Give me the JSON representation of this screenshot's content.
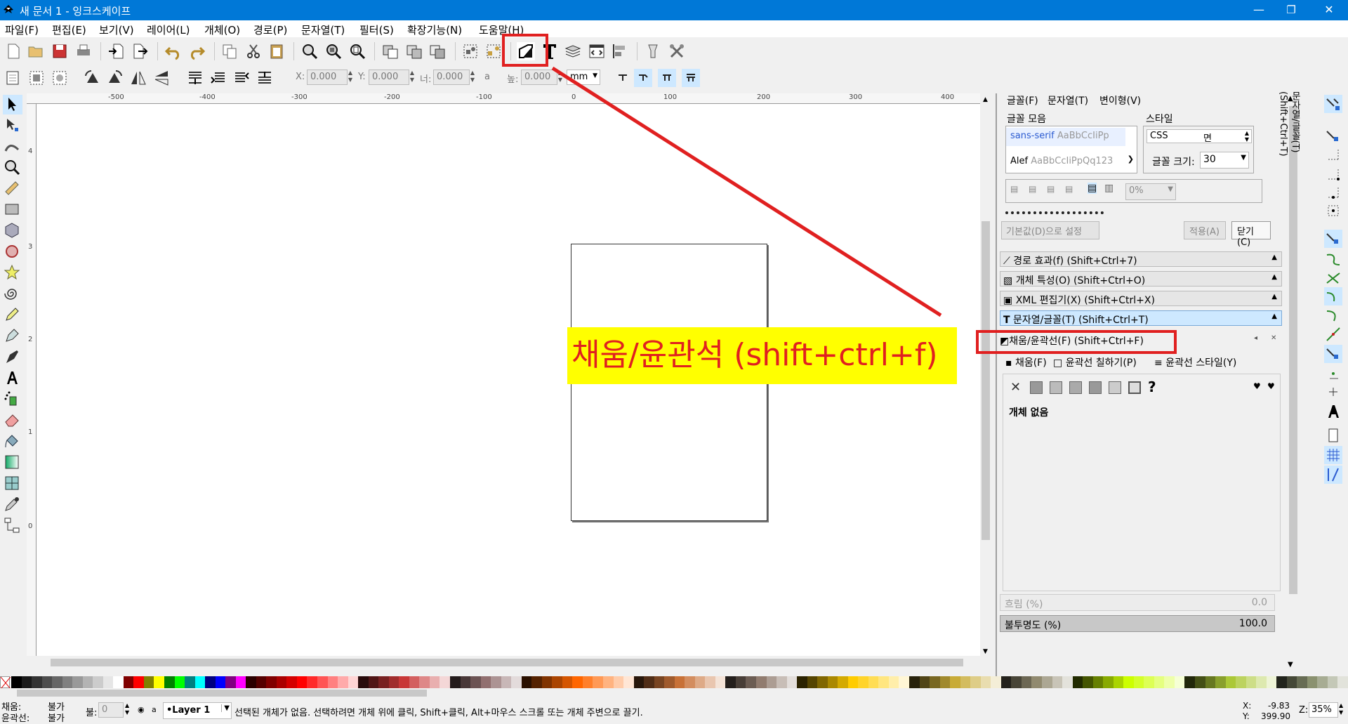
{
  "window": {
    "title": "새 문서 1 - 잉크스케이프",
    "minimize": "—",
    "maximize": "❐",
    "close": "✕"
  },
  "menu": [
    "파일(F)",
    "편집(E)",
    "보기(V)",
    "레이어(L)",
    "개체(O)",
    "경로(P)",
    "문자열(T)",
    "필터(S)",
    "확장기능(N)",
    "도움말(H)"
  ],
  "toolbar2": {
    "x_label": "X:",
    "x_value": "0.000",
    "y_label": "Y:",
    "y_value": "0.000",
    "w_label": "너:",
    "w_value": "0.000",
    "lock": "a",
    "h_label": "높:",
    "h_value": "0.000",
    "unit": "mm"
  },
  "rulers": {
    "h": [
      "-500",
      "-400",
      "-300",
      "-200",
      "-100",
      "0",
      "100",
      "200",
      "300",
      "400"
    ],
    "v": [
      "4",
      "3",
      "2",
      "1",
      "0"
    ]
  },
  "text_panel": {
    "tabs": [
      "글꼴(F)",
      "문자열(T)",
      "변이형(V)"
    ],
    "font_family_label": "글꼴 모음",
    "font1_name": "sans-serif",
    "font1_sample": "AaBbCcIiPp",
    "font2_name": "Alef",
    "font2_sample": "AaBbCcIiPpQq123",
    "style_label": "스타일",
    "css_label": "CSS",
    "style_value": "면",
    "size_label": "글꼴 크기:",
    "size_value": "30",
    "spacing_value": "0%",
    "default_button": "기본값(D)으로 설정",
    "apply_button": "적용(A)",
    "close_button": "닫기(C)"
  },
  "dock_panels": [
    "경로 효과(f) (Shift+Ctrl+7)",
    "개체 특성(O) (Shift+Ctrl+O)",
    "XML 편집기(X) (Shift+Ctrl+X)",
    "문자열/글꼴(T) (Shift+Ctrl+T)"
  ],
  "fill_panel": {
    "title": "채움/윤곽선(F) (Shift+Ctrl+F)",
    "tabs": [
      "채움(F)",
      "윤곽선 칠하기(P)",
      "윤곽선 스타일(Y)"
    ],
    "no_object": "개체 없음",
    "unknown": "?",
    "blur_label": "흐림 (%)",
    "blur_value": "0.0",
    "opacity_label": "불투명도 (%)",
    "opacity_value": "100.0"
  },
  "vertical_tab": "문자열/글꼴(T) (Shift+Ctrl+T)",
  "status": {
    "fill_label": "채움:",
    "fill_value": "불가",
    "stroke_label": "윤곽선:",
    "stroke_value": "불가",
    "opacity_label": "불:",
    "opacity_value": "0",
    "layer": "•Layer 1",
    "message": "선택된 개체가 없음. 선택하려면 개체 위에 클릭, Shift+클릭, Alt+마우스 스크롤 또는 개체 주변으로 끌기.",
    "x_label": "X:",
    "x_value": "-9.83",
    "y_label": "Y:",
    "y_value": "399.90",
    "zoom_label": "Z:",
    "zoom_value": "35%"
  },
  "annotation": {
    "text": "채움/윤관석 (shift+ctrl+f)",
    "color": "#e02020",
    "bg": "#ffff00"
  },
  "palette_colors": [
    "#000000",
    "#1a1a1a",
    "#333333",
    "#4d4d4d",
    "#666666",
    "#808080",
    "#999999",
    "#b3b3b3",
    "#cccccc",
    "#e6e6e6",
    "#ffffff",
    "#800000",
    "#ff0000",
    "#808000",
    "#ffff00",
    "#008000",
    "#00ff00",
    "#008080",
    "#00ffff",
    "#000080",
    "#0000ff",
    "#800080",
    "#ff00ff",
    "#2b0000",
    "#550000",
    "#800000",
    "#aa0000",
    "#d40000",
    "#ff0000",
    "#ff2a2a",
    "#ff5555",
    "#ff8080",
    "#ffaaaa",
    "#ffd5d5",
    "#280b0b",
    "#501616",
    "#782121",
    "#a02c2c",
    "#c83737",
    "#d35f5f",
    "#de8787",
    "#e9afaf",
    "#f4d7d7",
    "#241c1c",
    "#483737",
    "#6c5353",
    "#916f6f",
    "#ac9393",
    "#c8b7b7",
    "#e3dbdb",
    "#2b1100",
    "#552200",
    "#803300",
    "#aa4400",
    "#d45500",
    "#ff6600",
    "#ff7f2a",
    "#ff9955",
    "#ffb380",
    "#ffccaa",
    "#ffe6d5",
    "#28170b",
    "#502d16",
    "#784421",
    "#a05a2c",
    "#c87137",
    "#d38d5f",
    "#deaa87",
    "#e9c6af",
    "#f4e3d7",
    "#241f1c",
    "#483e37",
    "#6c5d53",
    "#917c6f",
    "#ac9d93",
    "#c8beb7",
    "#e3dedb",
    "#2b2200",
    "#554400",
    "#806600",
    "#aa8800",
    "#d4aa00",
    "#ffcc00",
    "#ffd42a",
    "#ffdd55",
    "#ffe680",
    "#ffeeaa",
    "#fff6d5",
    "#28220b",
    "#504416",
    "#786721",
    "#a0892c",
    "#c8ab37",
    "#d3bc5f",
    "#decd87",
    "#e9ddaf",
    "#f4eed7",
    "#24221c",
    "#484537",
    "#6c6753",
    "#918a6f",
    "#aca793",
    "#c8c4b7",
    "#e3e2db",
    "#222b00",
    "#445500",
    "#668000",
    "#88aa00",
    "#aad400",
    "#ccff00",
    "#d4ff2a",
    "#ddff55",
    "#e5ff80",
    "#eeffaa",
    "#f6ffd5",
    "#22280b",
    "#445016",
    "#677821",
    "#89a02c",
    "#abc837",
    "#bcd35f",
    "#cdde87",
    "#dde9af",
    "#eef4d7",
    "#22241c",
    "#454837",
    "#676c53",
    "#8a916f",
    "#a7ac93",
    "#c4c8b7",
    "#e2e3db"
  ]
}
